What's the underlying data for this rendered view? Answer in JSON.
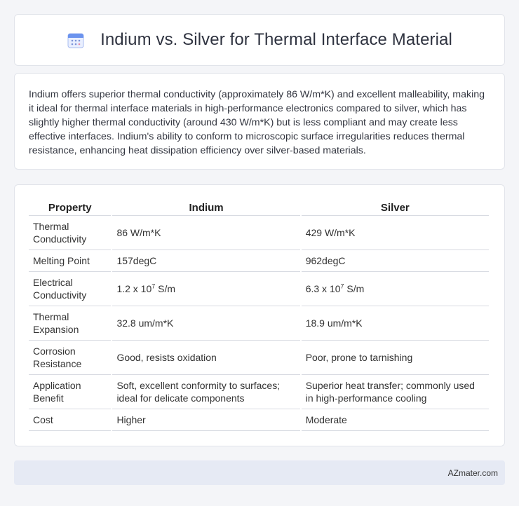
{
  "header": {
    "title": "Indium vs. Silver for Thermal Interface Material",
    "icon": "calendar-icon",
    "icon_color": "#5b8def"
  },
  "description": "Indium offers superior thermal conductivity (approximately 86 W/m*K) and excellent malleability, making it ideal for thermal interface materials in high-performance electronics compared to silver, which has slightly higher thermal conductivity (around 430 W/m*K) but is less compliant and may create less effective interfaces. Indium's ability to conform to microscopic surface irregularities reduces thermal resistance, enhancing heat dissipation efficiency over silver-based materials.",
  "table": {
    "headers": [
      "Property",
      "Indium",
      "Silver"
    ],
    "rows": [
      {
        "property": "Thermal Conductivity",
        "indium": "86 W/m*K",
        "silver": "429 W/m*K"
      },
      {
        "property": "Melting Point",
        "indium": "157degC",
        "silver": "962degC"
      },
      {
        "property": "Electrical Conductivity",
        "indium_base": "1.2 x 10",
        "indium_exp": "7",
        "indium_unit": " S/m",
        "silver_base": "6.3 x 10",
        "silver_exp": "7",
        "silver_unit": " S/m"
      },
      {
        "property": "Thermal Expansion",
        "indium": "32.8 um/m*K",
        "silver": "18.9 um/m*K"
      },
      {
        "property": "Corrosion Resistance",
        "indium": "Good, resists oxidation",
        "silver": "Poor, prone to tarnishing"
      },
      {
        "property": "Application Benefit",
        "indium": "Soft, excellent conformity to surfaces; ideal for delicate components",
        "silver": "Superior heat transfer; commonly used in high-performance cooling"
      },
      {
        "property": "Cost",
        "indium": "Higher",
        "silver": "Moderate"
      }
    ]
  },
  "footer": {
    "brand": "AZmater.com"
  }
}
